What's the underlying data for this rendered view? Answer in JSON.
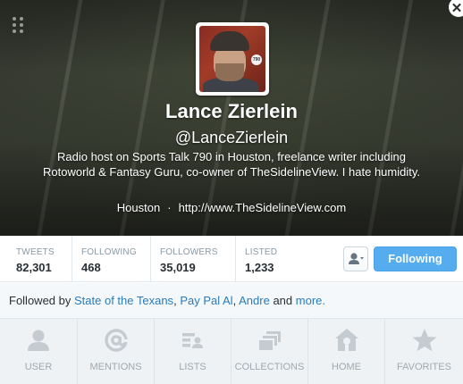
{
  "profile": {
    "name": "Lance Zierlein",
    "handle": "@LanceZierlein",
    "bio": "Radio host on Sports Talk 790 in Houston, freelance writer including Rotoworld & Fantasy Guru, co-owner of TheSidelineView. I hate humidity.",
    "location": "Houston",
    "separator": "·",
    "website": "http://www.TheSidelineView.com",
    "avatar_badge": "790"
  },
  "stats": [
    {
      "label": "TWEETS",
      "value": "82,301"
    },
    {
      "label": "FOLLOWING",
      "value": "468"
    },
    {
      "label": "FOLLOWERS",
      "value": "35,019"
    },
    {
      "label": "LISTED",
      "value": "1,233"
    }
  ],
  "actions": {
    "follow_label": "Following",
    "user_actions_icon": "user-dropdown-icon"
  },
  "followed_by": {
    "prefix": "Followed by",
    "users": [
      "State of the Texans",
      "Pay Pal Al",
      "Andre"
    ],
    "comma": ",",
    "and": "and",
    "more": "more",
    "period": "."
  },
  "nav": [
    {
      "label": "USER",
      "icon": "user-icon"
    },
    {
      "label": "MENTIONS",
      "icon": "at-icon"
    },
    {
      "label": "LISTS",
      "icon": "lists-icon"
    },
    {
      "label": "COLLECTIONS",
      "icon": "collections-icon"
    },
    {
      "label": "HOME",
      "icon": "home-icon"
    },
    {
      "label": "FAVORITES",
      "icon": "star-icon"
    }
  ],
  "colors": {
    "accent": "#55acee",
    "link": "#2b7bb9",
    "icon_gray": "#c4cbd1"
  }
}
